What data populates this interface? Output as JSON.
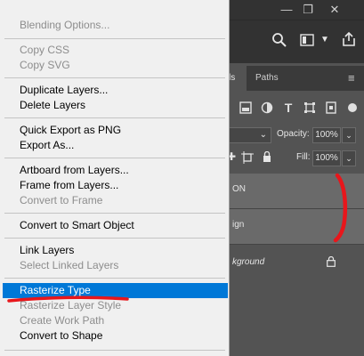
{
  "context_menu": {
    "items": [
      {
        "label": "Blending Options...",
        "enabled": false
      },
      {
        "label": "Copy CSS",
        "enabled": false
      },
      {
        "label": "Copy SVG",
        "enabled": false
      },
      {
        "label": "Duplicate Layers...",
        "enabled": true
      },
      {
        "label": "Delete Layers",
        "enabled": true
      },
      {
        "label": "Quick Export as PNG",
        "enabled": true
      },
      {
        "label": "Export As...",
        "enabled": true
      },
      {
        "label": "Artboard from Layers...",
        "enabled": true
      },
      {
        "label": "Frame from Layers...",
        "enabled": true
      },
      {
        "label": "Convert to Frame",
        "enabled": false
      },
      {
        "label": "Convert to Smart Object",
        "enabled": true
      },
      {
        "label": "Link Layers",
        "enabled": true
      },
      {
        "label": "Select Linked Layers",
        "enabled": false
      },
      {
        "label": "Rasterize Type",
        "enabled": true,
        "selected": true
      },
      {
        "label": "Rasterize Layer Style",
        "enabled": false
      },
      {
        "label": "Create Work Path",
        "enabled": false
      },
      {
        "label": "Convert to Shape",
        "enabled": true
      }
    ],
    "highlight_color": "#0078d7"
  },
  "layers_panel": {
    "tabs": [
      "ls",
      "Paths"
    ],
    "opacity_label": "Opacity:",
    "opacity_value": "100%",
    "fill_label": "Fill:",
    "fill_value": "100%",
    "layers": [
      {
        "name": "ON",
        "selected": true
      },
      {
        "name": "ign",
        "selected": true
      },
      {
        "name": "kground",
        "locked": true,
        "background": true
      }
    ]
  },
  "annotation_color": "#e8161b"
}
